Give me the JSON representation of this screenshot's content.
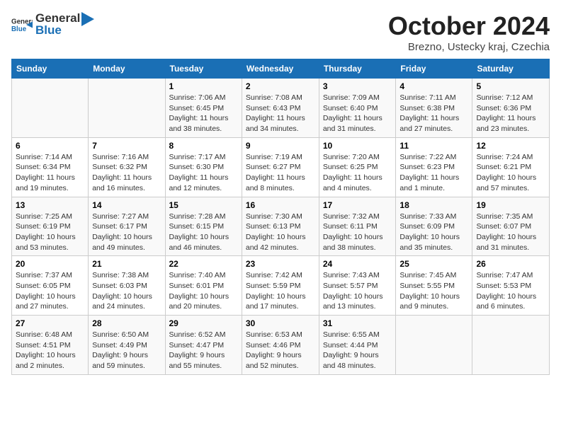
{
  "header": {
    "logo_general": "General",
    "logo_blue": "Blue",
    "title": "October 2024",
    "location": "Brezno, Ustecky kraj, Czechia"
  },
  "weekdays": [
    "Sunday",
    "Monday",
    "Tuesday",
    "Wednesday",
    "Thursday",
    "Friday",
    "Saturday"
  ],
  "weeks": [
    [
      {
        "day": "",
        "detail": ""
      },
      {
        "day": "",
        "detail": ""
      },
      {
        "day": "1",
        "detail": "Sunrise: 7:06 AM\nSunset: 6:45 PM\nDaylight: 11 hours and 38 minutes."
      },
      {
        "day": "2",
        "detail": "Sunrise: 7:08 AM\nSunset: 6:43 PM\nDaylight: 11 hours and 34 minutes."
      },
      {
        "day": "3",
        "detail": "Sunrise: 7:09 AM\nSunset: 6:40 PM\nDaylight: 11 hours and 31 minutes."
      },
      {
        "day": "4",
        "detail": "Sunrise: 7:11 AM\nSunset: 6:38 PM\nDaylight: 11 hours and 27 minutes."
      },
      {
        "day": "5",
        "detail": "Sunrise: 7:12 AM\nSunset: 6:36 PM\nDaylight: 11 hours and 23 minutes."
      }
    ],
    [
      {
        "day": "6",
        "detail": "Sunrise: 7:14 AM\nSunset: 6:34 PM\nDaylight: 11 hours and 19 minutes."
      },
      {
        "day": "7",
        "detail": "Sunrise: 7:16 AM\nSunset: 6:32 PM\nDaylight: 11 hours and 16 minutes."
      },
      {
        "day": "8",
        "detail": "Sunrise: 7:17 AM\nSunset: 6:30 PM\nDaylight: 11 hours and 12 minutes."
      },
      {
        "day": "9",
        "detail": "Sunrise: 7:19 AM\nSunset: 6:27 PM\nDaylight: 11 hours and 8 minutes."
      },
      {
        "day": "10",
        "detail": "Sunrise: 7:20 AM\nSunset: 6:25 PM\nDaylight: 11 hours and 4 minutes."
      },
      {
        "day": "11",
        "detail": "Sunrise: 7:22 AM\nSunset: 6:23 PM\nDaylight: 11 hours and 1 minute."
      },
      {
        "day": "12",
        "detail": "Sunrise: 7:24 AM\nSunset: 6:21 PM\nDaylight: 10 hours and 57 minutes."
      }
    ],
    [
      {
        "day": "13",
        "detail": "Sunrise: 7:25 AM\nSunset: 6:19 PM\nDaylight: 10 hours and 53 minutes."
      },
      {
        "day": "14",
        "detail": "Sunrise: 7:27 AM\nSunset: 6:17 PM\nDaylight: 10 hours and 49 minutes."
      },
      {
        "day": "15",
        "detail": "Sunrise: 7:28 AM\nSunset: 6:15 PM\nDaylight: 10 hours and 46 minutes."
      },
      {
        "day": "16",
        "detail": "Sunrise: 7:30 AM\nSunset: 6:13 PM\nDaylight: 10 hours and 42 minutes."
      },
      {
        "day": "17",
        "detail": "Sunrise: 7:32 AM\nSunset: 6:11 PM\nDaylight: 10 hours and 38 minutes."
      },
      {
        "day": "18",
        "detail": "Sunrise: 7:33 AM\nSunset: 6:09 PM\nDaylight: 10 hours and 35 minutes."
      },
      {
        "day": "19",
        "detail": "Sunrise: 7:35 AM\nSunset: 6:07 PM\nDaylight: 10 hours and 31 minutes."
      }
    ],
    [
      {
        "day": "20",
        "detail": "Sunrise: 7:37 AM\nSunset: 6:05 PM\nDaylight: 10 hours and 27 minutes."
      },
      {
        "day": "21",
        "detail": "Sunrise: 7:38 AM\nSunset: 6:03 PM\nDaylight: 10 hours and 24 minutes."
      },
      {
        "day": "22",
        "detail": "Sunrise: 7:40 AM\nSunset: 6:01 PM\nDaylight: 10 hours and 20 minutes."
      },
      {
        "day": "23",
        "detail": "Sunrise: 7:42 AM\nSunset: 5:59 PM\nDaylight: 10 hours and 17 minutes."
      },
      {
        "day": "24",
        "detail": "Sunrise: 7:43 AM\nSunset: 5:57 PM\nDaylight: 10 hours and 13 minutes."
      },
      {
        "day": "25",
        "detail": "Sunrise: 7:45 AM\nSunset: 5:55 PM\nDaylight: 10 hours and 9 minutes."
      },
      {
        "day": "26",
        "detail": "Sunrise: 7:47 AM\nSunset: 5:53 PM\nDaylight: 10 hours and 6 minutes."
      }
    ],
    [
      {
        "day": "27",
        "detail": "Sunrise: 6:48 AM\nSunset: 4:51 PM\nDaylight: 10 hours and 2 minutes."
      },
      {
        "day": "28",
        "detail": "Sunrise: 6:50 AM\nSunset: 4:49 PM\nDaylight: 9 hours and 59 minutes."
      },
      {
        "day": "29",
        "detail": "Sunrise: 6:52 AM\nSunset: 4:47 PM\nDaylight: 9 hours and 55 minutes."
      },
      {
        "day": "30",
        "detail": "Sunrise: 6:53 AM\nSunset: 4:46 PM\nDaylight: 9 hours and 52 minutes."
      },
      {
        "day": "31",
        "detail": "Sunrise: 6:55 AM\nSunset: 4:44 PM\nDaylight: 9 hours and 48 minutes."
      },
      {
        "day": "",
        "detail": ""
      },
      {
        "day": "",
        "detail": ""
      }
    ]
  ]
}
